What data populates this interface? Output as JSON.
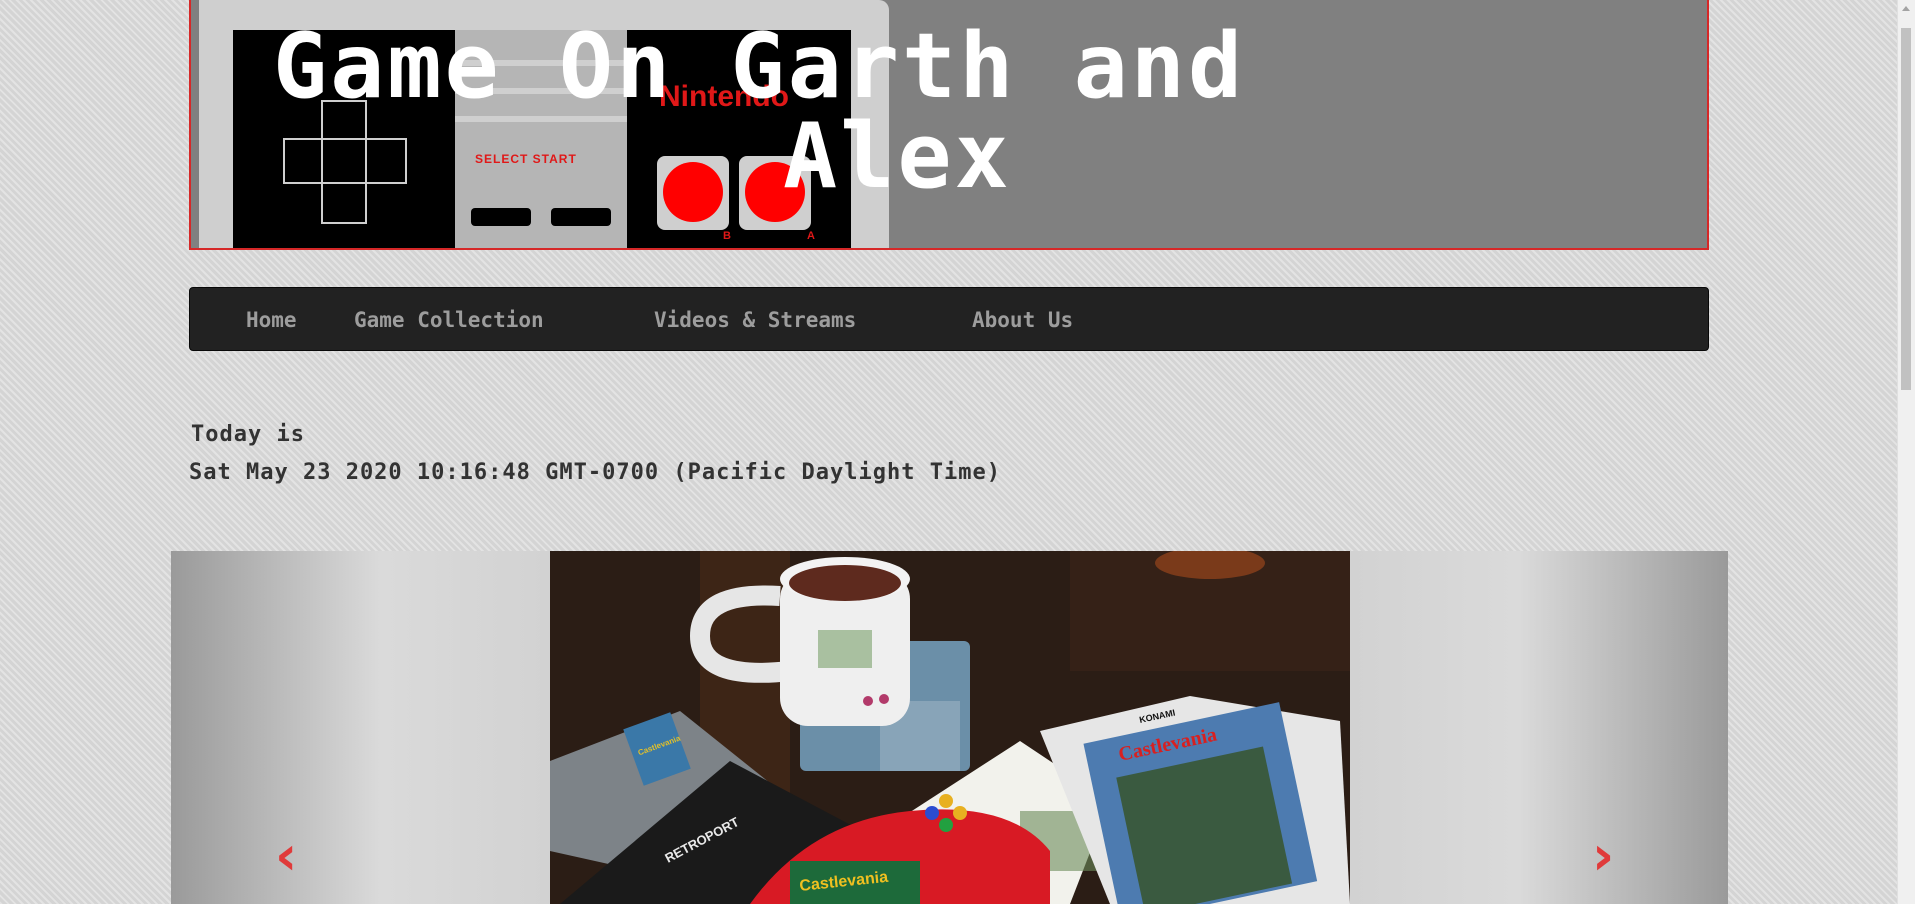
{
  "header": {
    "title_line1": "Game On Garth and",
    "title_line2": "Alex",
    "controller_brand": "Nintendo",
    "select_start": "SELECT  START",
    "button_b": "B",
    "button_a": "A"
  },
  "nav": {
    "items": [
      {
        "label": "Home"
      },
      {
        "label": "Game Collection"
      },
      {
        "label": "Videos & Streams"
      },
      {
        "label": "About Us"
      }
    ]
  },
  "date": {
    "label": "Today is",
    "value": "Sat May 23 2020 10:16:48 GMT-0700 (Pacific Daylight Time)"
  },
  "carousel": {
    "prev_icon": "chevron-left-icon",
    "next_icon": "chevron-right-icon",
    "prev_glyph": "‹",
    "next_glyph": "›",
    "photo_texts": {
      "konami": "KONAMI",
      "castlevania": "Castlevania",
      "retroport": "RETROPORT"
    }
  },
  "colors": {
    "accent": "#d62828",
    "nav_bg": "#222222",
    "nav_text": "#9d9d9d",
    "page_bg": "#d4d4d4"
  }
}
